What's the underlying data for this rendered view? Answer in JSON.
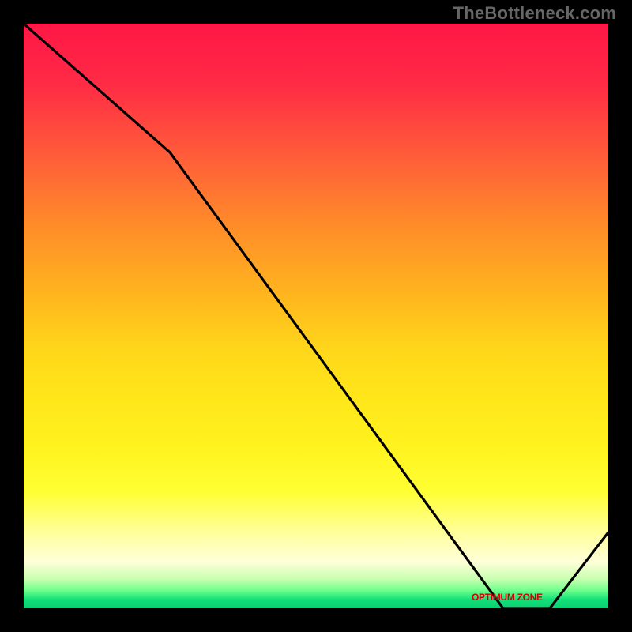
{
  "watermark": "TheBottleneck.com",
  "chart_data": {
    "type": "line",
    "title": "",
    "xlabel": "",
    "ylabel": "",
    "ylim": [
      0,
      100
    ],
    "x": [
      0,
      25,
      82,
      90,
      100
    ],
    "values": [
      100,
      78,
      0,
      0,
      13
    ],
    "series": [
      {
        "name": "curve",
        "values": [
          100,
          78,
          0,
          0,
          13
        ]
      }
    ],
    "bottom_band_label": "OPTIMUM ZONE"
  }
}
